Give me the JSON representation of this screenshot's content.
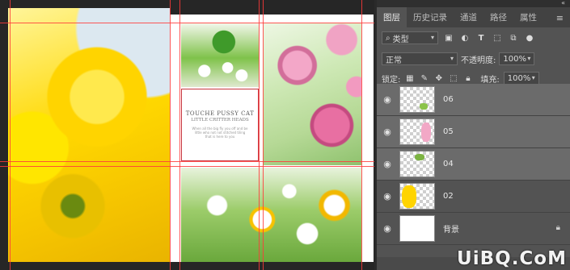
{
  "canvas": {
    "text_block": {
      "title": "TOUCHE PUSSY CAT",
      "subtitle": "LITTLE CRITTER HEADS",
      "body": "When all the big fly you off and be little who not not stitched tiling that is here to you"
    }
  },
  "panel": {
    "tabs": [
      "图层",
      "历史记录",
      "通道",
      "路径",
      "属性"
    ],
    "filter": {
      "kind_label": "类型",
      "search_icon": "search-icon"
    },
    "blend": {
      "mode": "正常",
      "opacity_label": "不透明度:",
      "opacity": "100%"
    },
    "lock": {
      "label": "锁定:",
      "fill_label": "填充:",
      "fill": "100%"
    },
    "layers": [
      {
        "name": "06",
        "selected": true
      },
      {
        "name": "05",
        "selected": true
      },
      {
        "name": "04",
        "selected": true
      },
      {
        "name": "02",
        "selected": false
      },
      {
        "name": "背景",
        "selected": false,
        "locked": true
      }
    ]
  },
  "watermark": "UiBQ.CoM",
  "colors": {
    "guide": "#ff3a3a",
    "panel_bg": "#535353",
    "selected_row": "#6b6b6b"
  }
}
